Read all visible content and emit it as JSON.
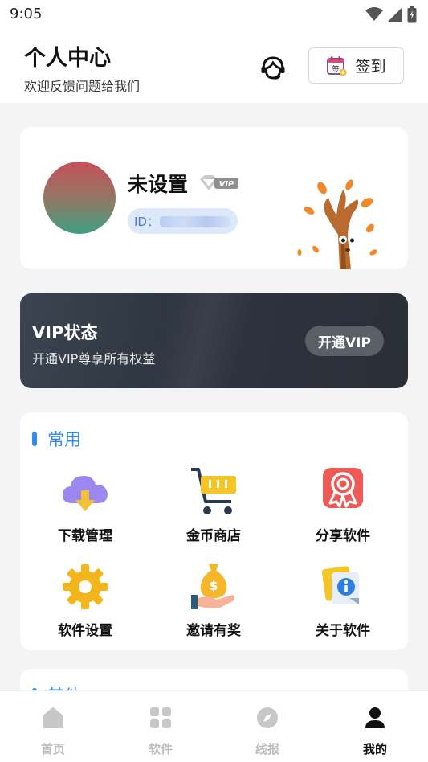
{
  "status_bar": {
    "time": "9:05"
  },
  "header": {
    "title": "个人中心",
    "subtitle": "欢迎反馈问题给我们",
    "signin_label": "签到",
    "signin_icon_char": "签"
  },
  "profile": {
    "username": "未设置",
    "vip_badge": "VIP",
    "id_label": "ID："
  },
  "vip_card": {
    "title": "VIP状态",
    "description": "开通VIP尊享所有权益",
    "button_label": "开通VIP"
  },
  "common": {
    "title": "常用",
    "items": [
      {
        "label": "下载管理",
        "icon": "cloud-download-icon"
      },
      {
        "label": "金币商店",
        "icon": "shopping-cart-icon"
      },
      {
        "label": "分享软件",
        "icon": "award-ribbon-icon"
      },
      {
        "label": "软件设置",
        "icon": "gear-icon"
      },
      {
        "label": "邀请有奖",
        "icon": "money-bag-icon"
      },
      {
        "label": "关于软件",
        "icon": "info-card-icon"
      }
    ]
  },
  "other": {
    "title": "其他"
  },
  "tabbar": {
    "items": [
      {
        "label": "首页",
        "icon": "home-icon",
        "active": false
      },
      {
        "label": "软件",
        "icon": "grid-icon",
        "active": false
      },
      {
        "label": "线报",
        "icon": "compass-icon",
        "active": false
      },
      {
        "label": "我的",
        "icon": "user-icon",
        "active": true
      }
    ]
  },
  "colors": {
    "accent": "#2f8df0",
    "vip_card_bg": "#2e3540",
    "page_bg": "#f4f4f5"
  }
}
